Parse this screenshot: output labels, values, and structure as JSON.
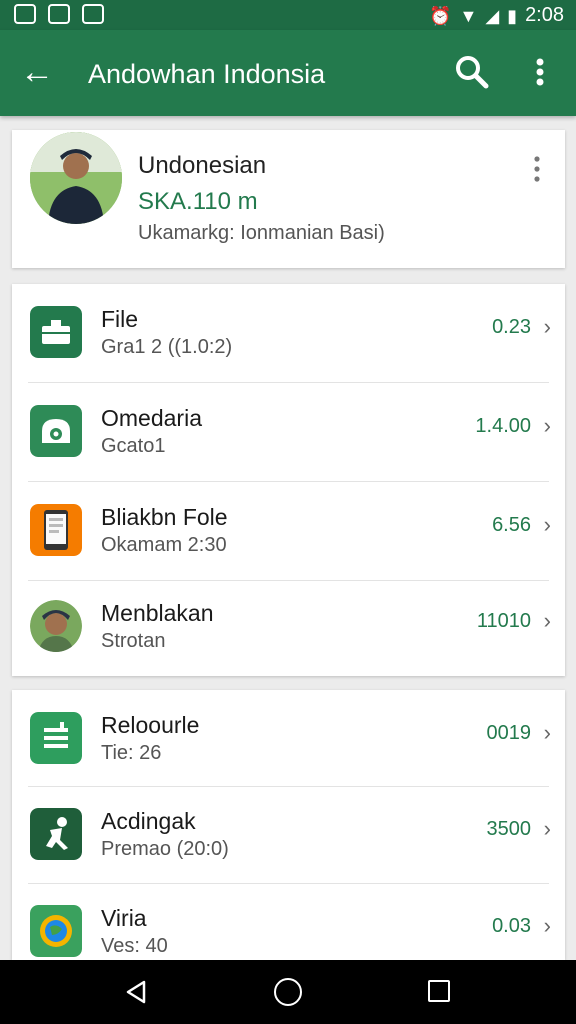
{
  "status_bar": {
    "time": "2:08"
  },
  "app_bar": {
    "title": "Andowhan Indonsia",
    "icons": [
      "back-arrow-icon",
      "search-icon",
      "more-vert-icon"
    ]
  },
  "profile": {
    "name": "Undonesian",
    "subtitle": "SKA.110 m",
    "description": "Ukamarkg: Ionmanian Basi)"
  },
  "list1": [
    {
      "title": "File",
      "subtitle": "Gra1 2 ((1.0:2)",
      "value": "0.23",
      "icon": "briefcase-icon",
      "icon_color": "#237a4d"
    },
    {
      "title": "Omedaria",
      "subtitle": "Gcato1",
      "value": "1.4.00",
      "icon": "camera-icon",
      "icon_color": "#2e8b57"
    },
    {
      "title": "Bliakbn Fole",
      "subtitle": "Okamam 2:30",
      "value": "6.56",
      "icon": "phone-icon",
      "icon_color": "#f57c00"
    },
    {
      "title": "Menblakan",
      "subtitle": "Strotan",
      "value": "11010",
      "icon": "avatar-icon",
      "icon_color": "#7aa85e"
    }
  ],
  "list2": [
    {
      "title": "Reloourle",
      "subtitle": "Tie: 26",
      "value": "0019",
      "icon": "list-icon",
      "icon_color": "#2e9e5e"
    },
    {
      "title": "Acdingak",
      "subtitle": "Premao (20:0)",
      "value": "3500",
      "icon": "runner-icon",
      "icon_color": "#1f5e3a"
    },
    {
      "title": "Viria",
      "subtitle": "Ves: 40",
      "value": "0.03",
      "icon": "globe-icon",
      "icon_color": "#3aa15e"
    }
  ]
}
